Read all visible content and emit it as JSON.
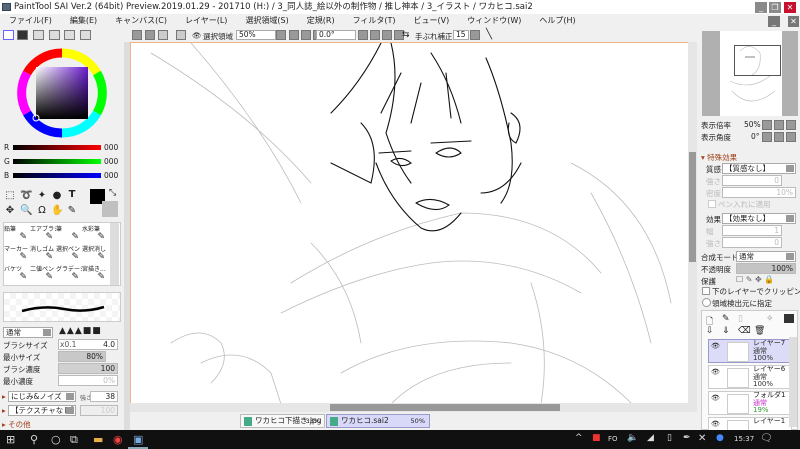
{
  "window": {
    "title": "PaintTool SAI Ver.2 (64bit) Preview.2019.01.29 - 201710 (H:) / 3_同人誌_絵以外の制作物 / 推し神本 / 3_イラスト / ワカヒコ.sai2",
    "minimize": "_",
    "restore": "❐",
    "close": "✕"
  },
  "menu": [
    "ファイル(F)",
    "編集(E)",
    "キャンバス(C)",
    "レイヤー(L)",
    "選択領域(S)",
    "定規(R)",
    "フィルタ(T)",
    "ビュー(V)",
    "ウィンドウ(W)",
    "ヘルプ(H)"
  ],
  "toolbar": {
    "selection_label": "選択領域",
    "zoom": "50%",
    "angle": "0.0°",
    "stabilizer_label": "手ぶれ補正",
    "stabilizer": "15"
  },
  "color": {
    "r_label": "R",
    "g_label": "G",
    "b_label": "B",
    "r": "000",
    "g": "000",
    "b": "000",
    "fg": "#000000",
    "bg": "#c0c0c0"
  },
  "tools": {
    "text_tool": "T"
  },
  "brushes": [
    {
      "label": "鉛筆"
    },
    {
      "label": "エアブラシ"
    },
    {
      "label": "筆"
    },
    {
      "label": "水彩筆"
    },
    {
      "label": "マーカー"
    },
    {
      "label": "消しゴム"
    },
    {
      "label": "選択ペン"
    },
    {
      "label": "選択消し"
    },
    {
      "label": "バケツ"
    },
    {
      "label": "二値ペン"
    },
    {
      "label": "グラデーション"
    },
    {
      "label": "宮描き..."
    }
  ],
  "brush_settings": {
    "blend_mode": "通常",
    "size_label": "ブラシサイズ",
    "size_mult": "x0.1",
    "size": "4.0",
    "min_size_label": "最小サイズ",
    "min_size": "80%",
    "density_label": "ブラシ濃度",
    "density": "100",
    "min_density_label": "最小濃度",
    "min_density": "0%",
    "blur_label": "にじみ&ノイズ",
    "strength_label": "強さ",
    "strength": "38",
    "texture_label": "【テクスチャなし】",
    "texture_strength": "100",
    "other_label": "その他"
  },
  "navigator": {
    "zoom_label": "表示倍率",
    "zoom": "50%",
    "angle_label": "表示角度",
    "angle": "0°"
  },
  "effects": {
    "section": "特殊効果",
    "paper_label": "質感",
    "paper": "【質感なし】",
    "strength_label": "強さ",
    "strength": "0",
    "density_label": "密度",
    "density": "10%",
    "pen_apply": "ペン入れに適用",
    "effect_label": "効果",
    "effect": "【効果なし】",
    "width_label": "幅",
    "width": "1",
    "strength2_label": "強さ",
    "strength2": "0"
  },
  "layer_props": {
    "blend_label": "合成モード",
    "blend": "通常",
    "opacity_label": "不透明度",
    "opacity": "100%",
    "protect_label": "保護",
    "clip_label": "下のレイヤーでクリッピング",
    "source_label": "領域検出元に指定"
  },
  "layers": [
    {
      "name": "レイヤー7",
      "mode": "通常",
      "opacity": "100%",
      "selected": true
    },
    {
      "name": "レイヤー6",
      "mode": "通常",
      "opacity": "100%",
      "selected": false
    },
    {
      "name": "フォルダ1",
      "mode": "通常",
      "opacity": "19%",
      "selected": false
    },
    {
      "name": "レイヤー1",
      "mode": "",
      "opacity": "",
      "selected": false
    }
  ],
  "tabs": [
    {
      "name": "ワカヒコ下描き.jpg",
      "zoom": "33%"
    },
    {
      "name": "ワカヒコ.sai2",
      "zoom": "50%",
      "active": true
    }
  ],
  "taskbar": {
    "time": "15:37",
    "ime": "FO"
  }
}
